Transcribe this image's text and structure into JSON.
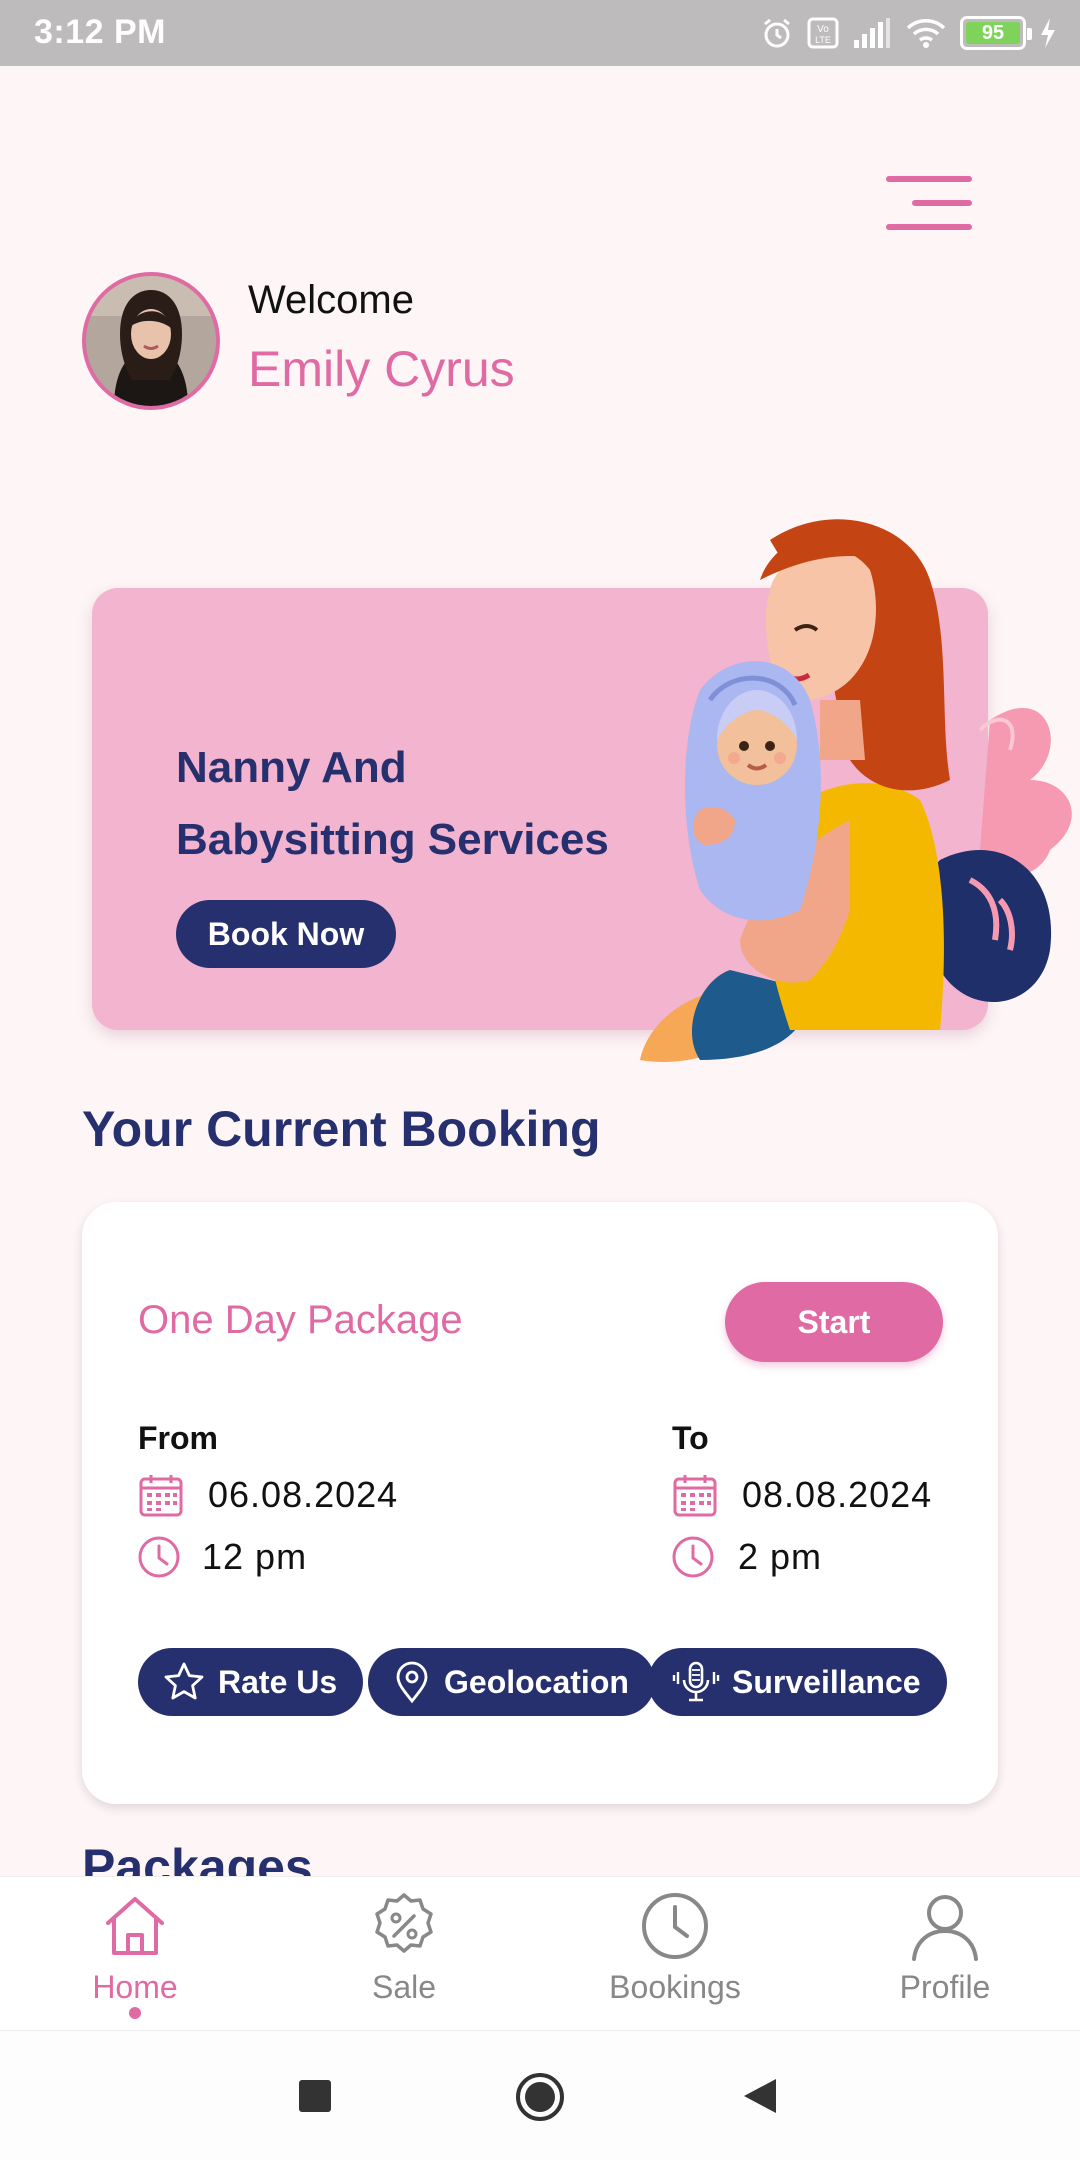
{
  "status_bar": {
    "time": "3:12 PM",
    "battery": "95",
    "icons": [
      "alarm-icon",
      "volte-icon",
      "signal-icon",
      "wifi-icon",
      "battery-icon",
      "charging-icon"
    ]
  },
  "header": {
    "greeting": "Welcome",
    "user_name": "Emily Cyrus",
    "menu_icon": "hamburger-menu-icon"
  },
  "hero": {
    "title_line1": "Nanny And",
    "title_line2": "Babysitting Services",
    "cta_label": "Book Now",
    "illustration": "mother-holding-baby"
  },
  "current_booking": {
    "section_title": "Your Current Booking",
    "package_name": "One Day Package",
    "start_label": "Start",
    "from": {
      "label": "From",
      "date": "06.08.2024",
      "time": "12 pm"
    },
    "to": {
      "label": "To",
      "date": "08.08.2024",
      "time": "2 pm"
    },
    "actions": [
      {
        "label": "Rate Us",
        "icon": "star-icon"
      },
      {
        "label": "Geolocation",
        "icon": "location-pin-icon"
      },
      {
        "label": "Surveillance",
        "icon": "microphone-icon"
      }
    ]
  },
  "packages": {
    "section_title": "Packages"
  },
  "bottom_nav": {
    "items": [
      {
        "label": "Home",
        "icon": "home-icon",
        "active": true
      },
      {
        "label": "Sale",
        "icon": "sale-badge-icon",
        "active": false
      },
      {
        "label": "Bookings",
        "icon": "clock-icon",
        "active": false
      },
      {
        "label": "Profile",
        "icon": "user-icon",
        "active": false
      }
    ]
  },
  "colors": {
    "accent_pink": "#e06aa3",
    "navy": "#27306e",
    "banner_pink": "#f2b4cf",
    "background": "#fdf5f6"
  }
}
